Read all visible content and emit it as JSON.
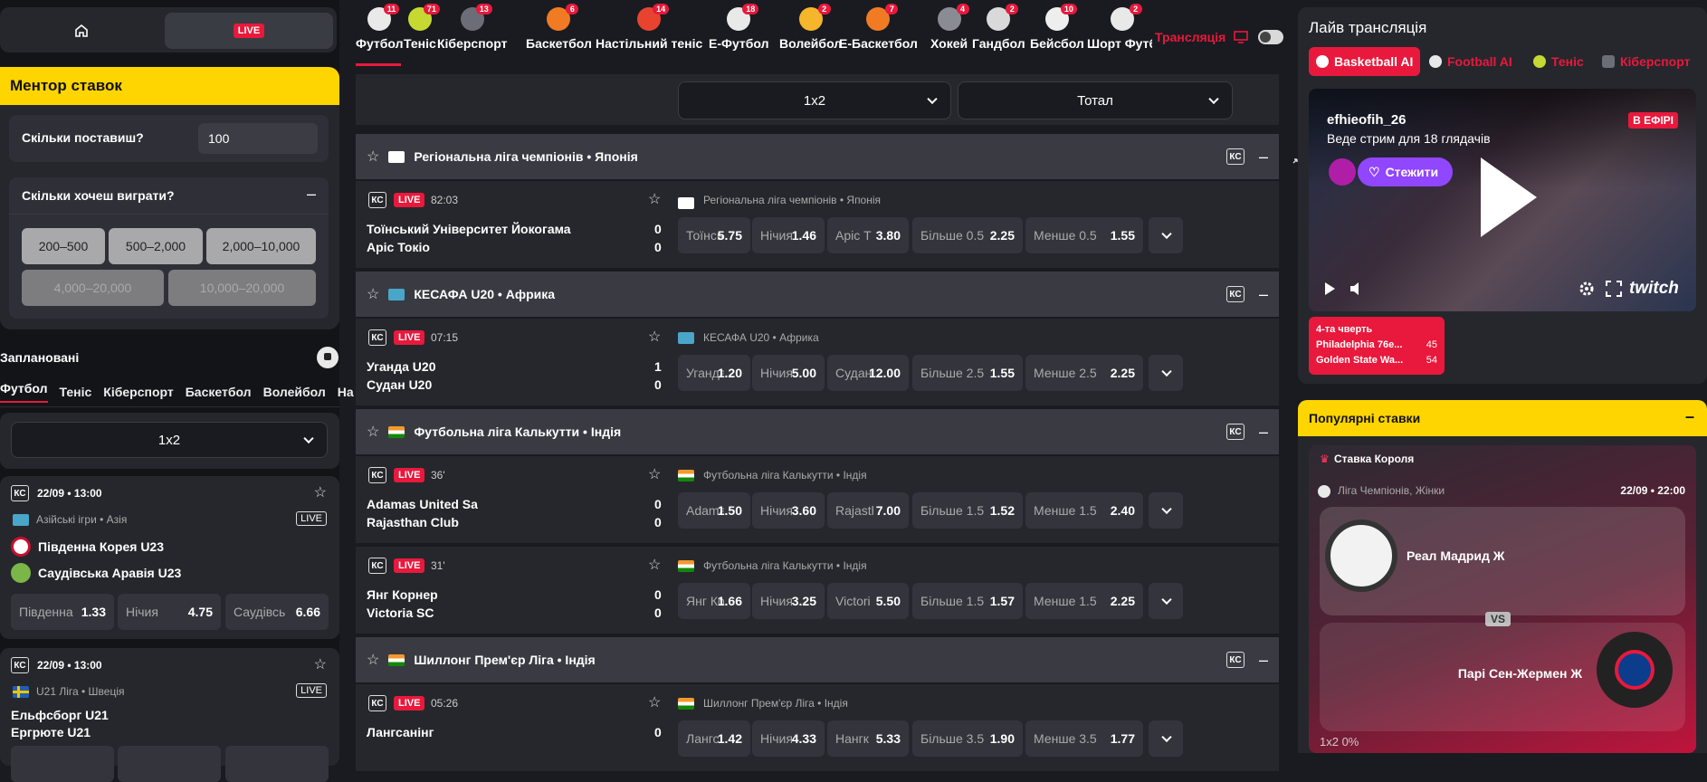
{
  "left": {
    "live_label": "LIVE",
    "mentor": {
      "title": "Ментор ставок",
      "q1": "Скільки поставиш?",
      "amount": "100",
      "q2": "Скільки хочеш виграти?",
      "chips": [
        "200–500",
        "500–2,000",
        "2,000–10,000",
        "4,000–20,000",
        "10,000–20,000"
      ]
    },
    "scheduled": {
      "title": "Заплановані",
      "tabs": [
        "Футбол",
        "Теніс",
        "Кіберспорт",
        "Баскетбол",
        "Волейбол",
        "Ha"
      ],
      "select": "1x2"
    },
    "events": [
      {
        "ks": "КС",
        "datetime": "22/09 • 13:00",
        "league": "Азійські ігри • Азія",
        "live": "LIVE",
        "team1": "Південна Корея U23",
        "team2": "Саудівська Аравія U23",
        "odds": [
          {
            "n": "Південна",
            "v": "1.33"
          },
          {
            "n": "Нічия",
            "v": "4.75"
          },
          {
            "n": "Саудівсь",
            "v": "6.66"
          }
        ]
      },
      {
        "ks": "КС",
        "datetime": "22/09 • 13:00",
        "league": "U21 Ліга • Швеція",
        "live": "LIVE",
        "team1": "Ельфсборг U21",
        "team2": "Ергрюте U21"
      }
    ]
  },
  "center": {
    "sports": [
      {
        "label": "Футбол",
        "count": "11",
        "color": "#e9e9e9"
      },
      {
        "label": "Теніс",
        "count": "71",
        "color": "#c5d932"
      },
      {
        "label": "Кіберспорт",
        "count": "13",
        "color": "#6b6e77"
      },
      {
        "label": "Баскетбол",
        "count": "6",
        "color": "#f07b22"
      },
      {
        "label": "Настільний теніс",
        "count": "14",
        "color": "#e8432e"
      },
      {
        "label": "Е-Футбол",
        "count": "18",
        "color": "#e9e9e9"
      },
      {
        "label": "Волейбол",
        "count": "2",
        "color": "#f5b62b"
      },
      {
        "label": "Е-Баскетбол",
        "count": "7",
        "color": "#f07b22"
      },
      {
        "label": "Хокей",
        "count": "4",
        "color": "#8a8c93"
      },
      {
        "label": "Гандбол",
        "count": "2",
        "color": "#d9d9d9"
      },
      {
        "label": "Бейсбол",
        "count": "10",
        "color": "#eeeeee"
      },
      {
        "label": "Шорт Футб",
        "count": "2",
        "color": "#e9e9e9"
      }
    ],
    "broadcast_label": "Трансляція",
    "select1": "1x2",
    "select2": "Тотал",
    "groups": [
      {
        "league": "Регіональна ліга чемпіонів • Японія",
        "flag": "jp",
        "matches": [
          {
            "time": "82:03",
            "league": "Регіональна ліга чемпіонів • Японія",
            "team1": "Тоїнський Університет Йокогама",
            "team2": "Аріс Токіо",
            "s1": "0",
            "s2": "0",
            "odds": [
              {
                "n": "Тоїнськ",
                "v": "5.75"
              },
              {
                "n": "Нічия",
                "v": "1.46"
              },
              {
                "n": "Аріс Т",
                "v": "3.80"
              },
              {
                "n": "Більше 0.5",
                "v": "2.25"
              },
              {
                "n": "Менше 0.5",
                "v": "1.55"
              }
            ]
          }
        ]
      },
      {
        "league": "КЕСАФА U20 • Африка",
        "flag": "af",
        "matches": [
          {
            "time": "07:15",
            "league": "КЕСАФА U20 • Африка",
            "team1": "Уганда U20",
            "team2": "Судан U20",
            "s1": "1",
            "s2": "0",
            "odds": [
              {
                "n": "Уганда",
                "v": "1.20"
              },
              {
                "n": "Нічия",
                "v": "5.00"
              },
              {
                "n": "Судан",
                "v": "12.00"
              },
              {
                "n": "Більше 2.5",
                "v": "1.55"
              },
              {
                "n": "Менше 2.5",
                "v": "2.25"
              }
            ]
          }
        ]
      },
      {
        "league": "Футбольна ліга Калькутти • Індія",
        "flag": "in",
        "matches": [
          {
            "time": "36'",
            "league": "Футбольна ліга Калькутти • Індія",
            "team1": "Adamas United Sa",
            "team2": "Rajasthan Club",
            "s1": "0",
            "s2": "0",
            "odds": [
              {
                "n": "Adama",
                "v": "1.50"
              },
              {
                "n": "Нічия",
                "v": "3.60"
              },
              {
                "n": "Rajasth",
                "v": "7.00"
              },
              {
                "n": "Більше 1.5",
                "v": "1.52"
              },
              {
                "n": "Менше 1.5",
                "v": "2.40"
              }
            ]
          },
          {
            "time": "31'",
            "league": "Футбольна ліга Калькутти • Індія",
            "team1": "Янг Корнер",
            "team2": "Victoria SC",
            "s1": "0",
            "s2": "0",
            "odds": [
              {
                "n": "Янг Ко",
                "v": "1.66"
              },
              {
                "n": "Нічия",
                "v": "3.25"
              },
              {
                "n": "Victori",
                "v": "5.50"
              },
              {
                "n": "Більше 1.5",
                "v": "1.57"
              },
              {
                "n": "Менше 1.5",
                "v": "2.25"
              }
            ]
          }
        ]
      },
      {
        "league": "Шиллонг Прем'єр Ліга • Індія",
        "flag": "in",
        "matches": [
          {
            "time": "05:26",
            "league": "Шиллонг Прем'єр Ліга • Індія",
            "team1": "Лангсанінг",
            "team2": "",
            "s1": "0",
            "s2": "",
            "odds": [
              {
                "n": "Лангс",
                "v": "1.42"
              },
              {
                "n": "Нічия",
                "v": "4.33"
              },
              {
                "n": "Нангк",
                "v": "5.33"
              },
              {
                "n": "Більше 3.5",
                "v": "1.90"
              },
              {
                "n": "Менше 3.5",
                "v": "1.77"
              }
            ]
          }
        ]
      }
    ],
    "ks": "КС",
    "live": "LIVE"
  },
  "right": {
    "title": "Лайв трансляція",
    "tabs": [
      "Basketball AI",
      "Football AI",
      "Теніс",
      "Кіберспорт"
    ],
    "stream": {
      "user": "efhieofih_26",
      "sub": "Веде стрим для 18 глядачів",
      "badge": "В ЕФІРІ",
      "follow": "Стежити",
      "brand": "twitch"
    },
    "score_card": {
      "period": "4-та чверть",
      "team1": "Philadelphia 76e...",
      "s1": "45",
      "team2": "Golden State Wa...",
      "s2": "54"
    },
    "popular": {
      "title": "Популярні ставки",
      "king": "Ставка Короля",
      "league": "Ліга Чемпіонів, Жінки",
      "datetime": "22/09 • 22:00",
      "team1": "Реал Мадрид Ж",
      "vs": "VS",
      "team2": "Парі Сен-Жермен Ж",
      "bottom": "1x2 0%"
    }
  }
}
